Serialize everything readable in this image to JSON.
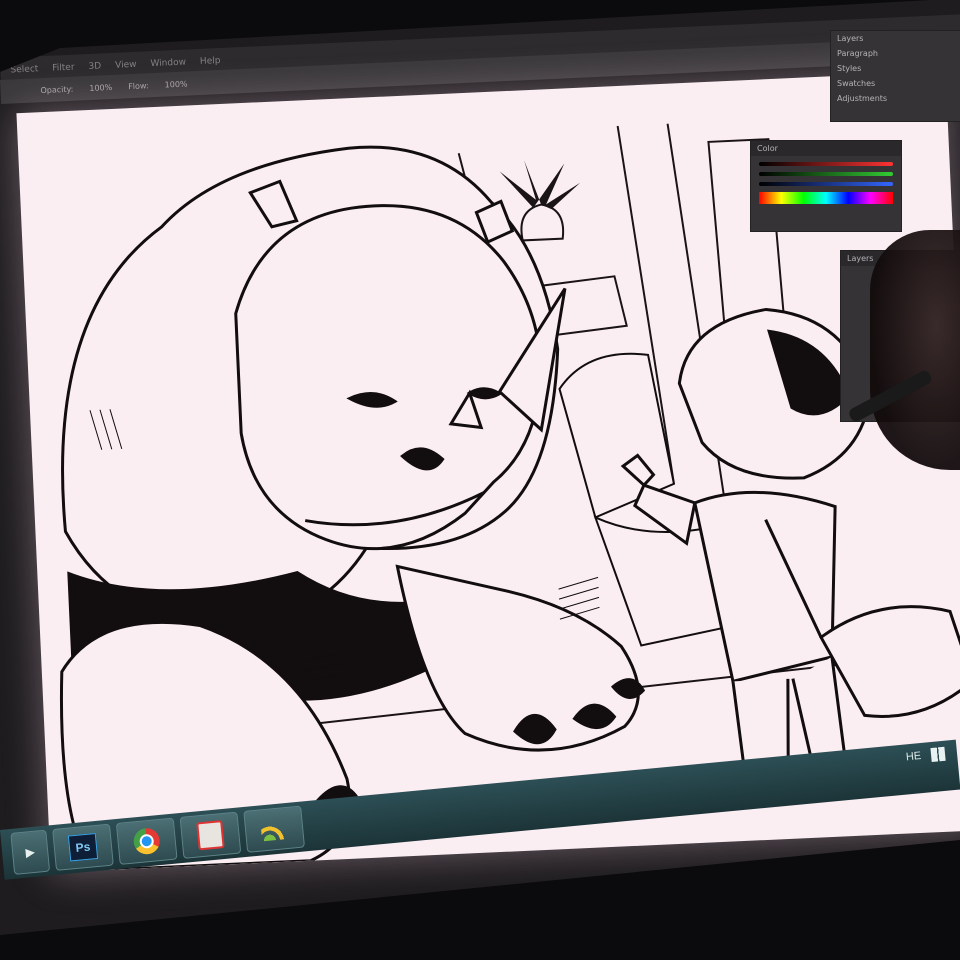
{
  "menubar": {
    "items": [
      "Select",
      "Filter",
      "3D",
      "View",
      "Window",
      "Help"
    ]
  },
  "optionsbar": {
    "opacity_label": "Opacity:",
    "opacity_value": "100%",
    "flow_label": "Flow:",
    "flow_value": "100%"
  },
  "panels": {
    "color_title": "Color",
    "layers_title": "Layers",
    "adjust_items": [
      "Layers",
      "Paragraph",
      "Styles",
      "Swatches",
      "Adjustments"
    ]
  },
  "taskbar": {
    "apps": [
      {
        "name": "photoshop",
        "label": "Ps"
      },
      {
        "name": "chrome",
        "label": ""
      },
      {
        "name": "app-red",
        "label": ""
      },
      {
        "name": "wifi-app",
        "label": ""
      }
    ],
    "language": "HE"
  },
  "colors": {
    "canvas": "#fbeef3",
    "taskbar": "#2c4f55",
    "panel": "#353336"
  },
  "artwork": {
    "subject": "ink drawing of a rhinoceros and a child in a room"
  }
}
